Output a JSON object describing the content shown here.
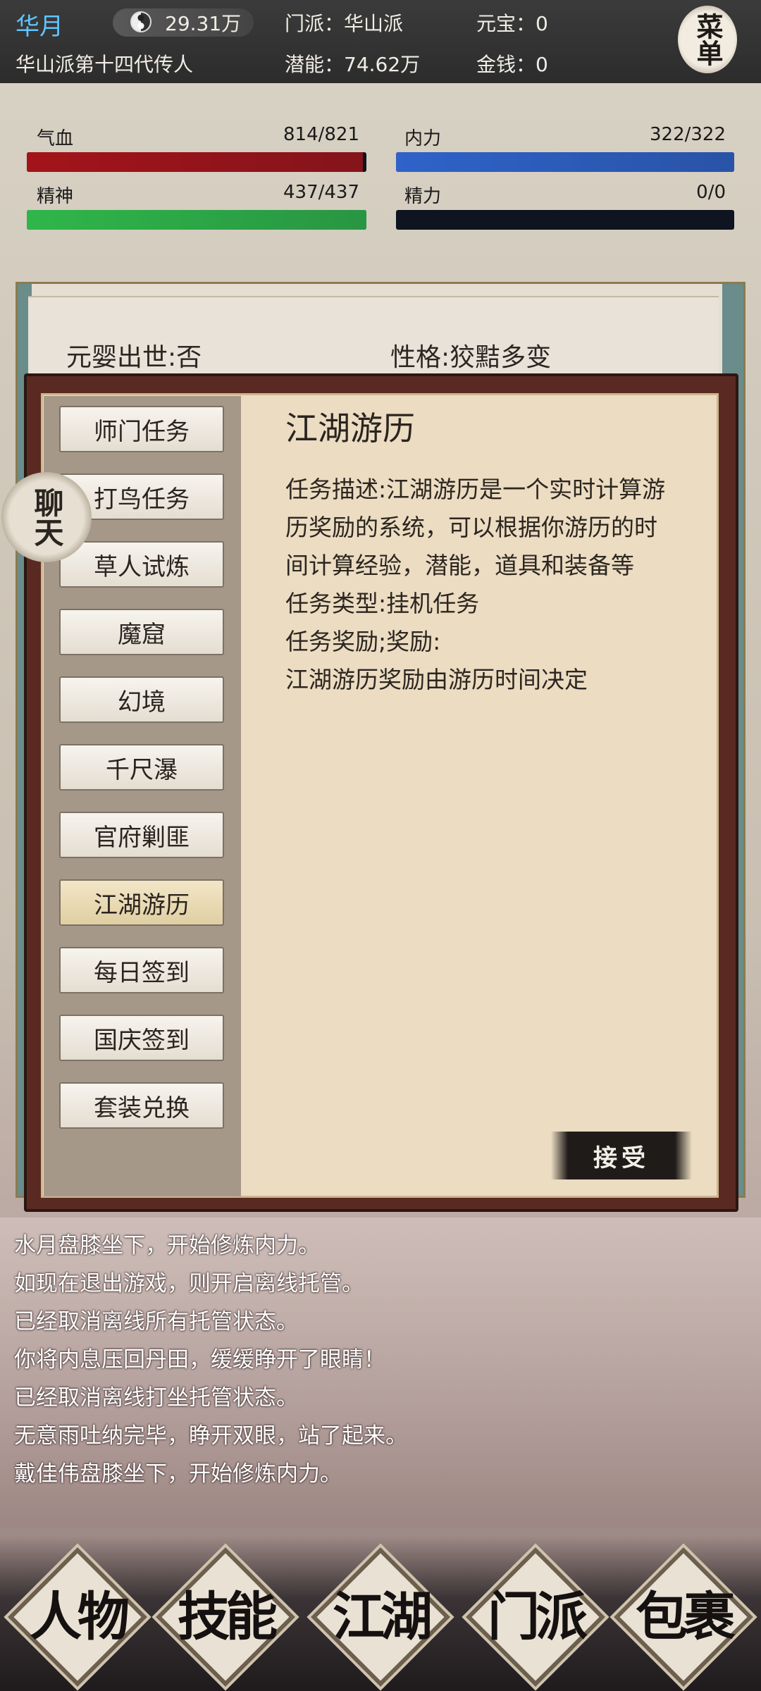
{
  "header": {
    "player_name": "华月",
    "title": "华山派第十四代传人",
    "money": "29.31万",
    "sect": "门派：华山派",
    "potential": "潜能：74.62万",
    "yuanbao": "元宝：0",
    "gold": "金钱：0",
    "menu_label": "菜单"
  },
  "stats": {
    "hp": {
      "label": "气血",
      "value": "814/821",
      "fill_fraction": 0.99,
      "color": "#a3141a"
    },
    "neili": {
      "label": "内力",
      "value": "322/322",
      "fill_fraction": 1.0,
      "color": "#2f63c9"
    },
    "jingshen": {
      "label": "精神",
      "value": "437/437",
      "fill_fraction": 1.0,
      "color": "#2fb64a"
    },
    "jingli": {
      "label": "精力",
      "value": "0/0",
      "fill_fraction": 0.0,
      "color": "#1a2a40"
    }
  },
  "info": {
    "yuanying": "元婴出世:否",
    "personality": "性格:狡黠多变"
  },
  "tabs": [
    {
      "label": "师门任务"
    },
    {
      "label": "打鸟任务"
    },
    {
      "label": "草人试炼"
    },
    {
      "label": "魔窟"
    },
    {
      "label": "幻境"
    },
    {
      "label": "千尺瀑"
    },
    {
      "label": "官府剿匪"
    },
    {
      "label": "江湖游历",
      "active": true
    },
    {
      "label": "每日签到"
    },
    {
      "label": "国庆签到"
    },
    {
      "label": "套装兑换"
    }
  ],
  "task": {
    "title": "江湖游历",
    "lines": [
      "任务描述:江湖游历是一个实时计算游",
      "历奖励的系统，可以根据你游历的时",
      "间计算经验，潜能，道具和装备等",
      "任务类型:挂机任务",
      "任务奖励;奖励:",
      "江湖游历奖励由游历时间决定"
    ],
    "accept_label": "接受"
  },
  "chat_label": "聊天",
  "log": [
    "水月盘膝坐下，开始修炼内力。",
    "如现在退出游戏，则开启离线托管。",
    "已经取消离线所有托管状态。",
    "你将内息压回丹田，缓缓睁开了眼睛！",
    "已经取消离线打坐托管状态。",
    "无意雨吐纳完毕，睁开双眼，站了起来。",
    "戴佳伟盘膝坐下，开始修炼内力。"
  ],
  "nav": [
    {
      "label": "人物"
    },
    {
      "label": "技能"
    },
    {
      "label": "江湖"
    },
    {
      "label": "门派"
    },
    {
      "label": "包裹"
    }
  ]
}
